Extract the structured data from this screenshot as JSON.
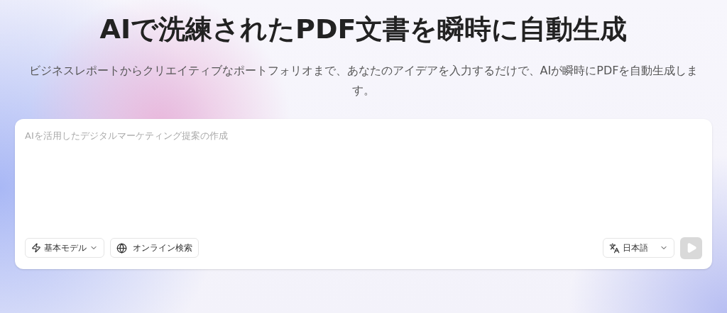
{
  "hero": {
    "title": "AIで洗練されたPDF文書を瞬時に自動生成",
    "subtitle": "ビジネスレポートからクリエイティブなポートフォリオまで、あなたのアイデアを入力するだけで、AIが瞬時にPDFを自動生成します。"
  },
  "prompt": {
    "placeholder": "AIを活用したデジタルマーケティング提案の作成"
  },
  "toolbar": {
    "model": {
      "label": "基本モデル"
    },
    "search": {
      "label": "オンライン検索"
    },
    "language": {
      "label": "日本語"
    },
    "send": {
      "disabled": true
    }
  }
}
